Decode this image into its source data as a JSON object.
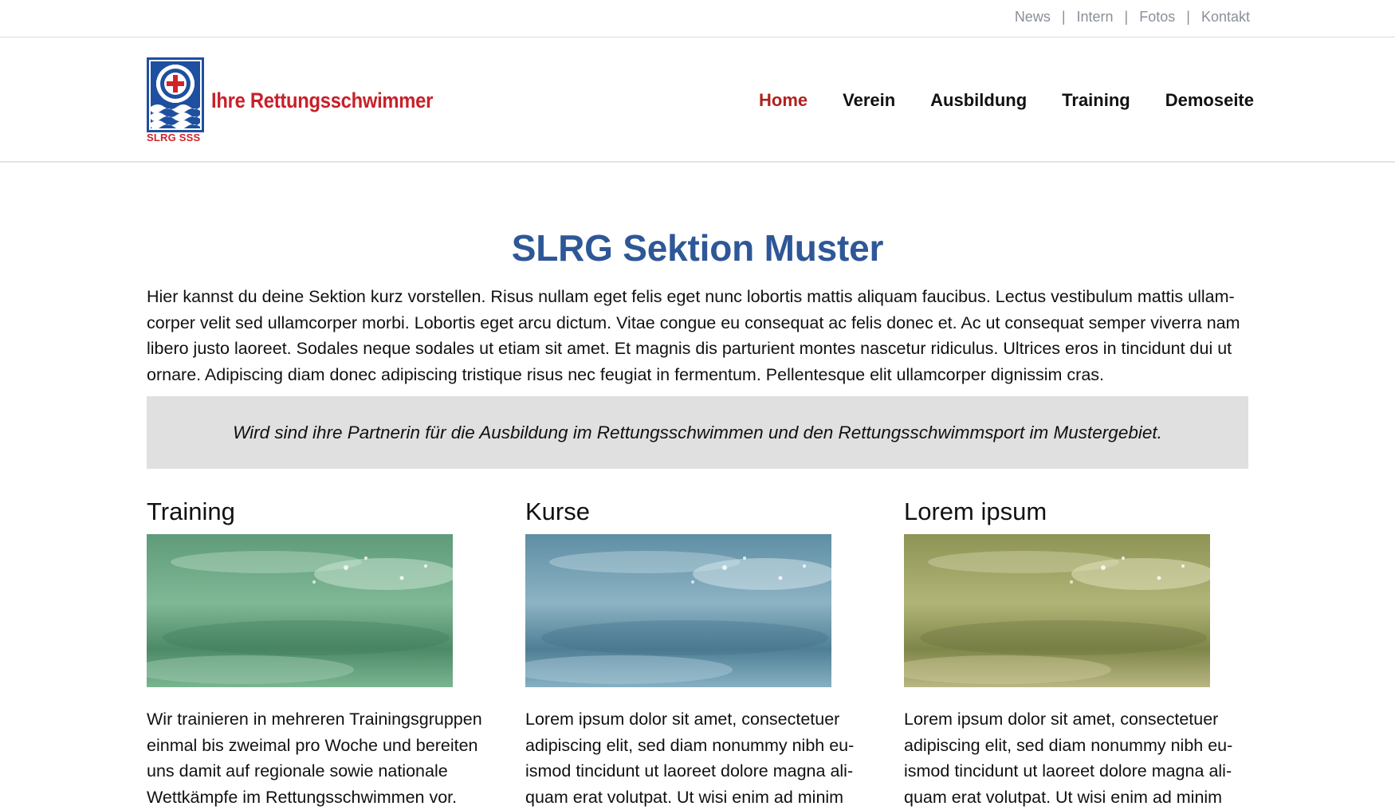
{
  "utility_nav": {
    "items": [
      "News",
      "Intern",
      "Fotos",
      "Kontakt"
    ],
    "separator": "|"
  },
  "logo": {
    "title": "Ihre Rettungsschwimmer",
    "subtitle": "SLRG SSS",
    "icon": "lifebuoy-cross-waves-icon"
  },
  "main_nav": {
    "items": [
      {
        "label": "Home",
        "active": true
      },
      {
        "label": "Verein",
        "active": false
      },
      {
        "label": "Ausbildung",
        "active": false
      },
      {
        "label": "Training",
        "active": false
      },
      {
        "label": "Demoseite",
        "active": false
      }
    ]
  },
  "page": {
    "title": "SLRG Sektion Muster",
    "intro": "Hier kannst du deine Sektion kurz vorstellen. Risus nullam eget felis eget nunc lobortis mattis aliquam faucibus. Lectus vestibulum mattis ullam­corper velit sed ullamcorper morbi. Lobortis eget arcu dictum. Vitae congue eu consequat ac felis donec et. Ac ut consequat semper viverra nam libero justo laoreet. Sodales neque sodales ut etiam sit amet. Et magnis dis parturient montes nascetur ridiculus. Ultrices eros in tincidunt dui ut ornare. Adipiscing diam donec adipiscing tristique risus nec feugiat in fermentum. Pellentesque elit ullamcorper dignissim cras.",
    "quote": "Wird sind ihre Partnerin für die Ausbildung im Rettungsschwimmen und den Rettungsschwimmsport im Mustergebiet."
  },
  "columns": [
    {
      "heading": "Training",
      "text": "Wir trainieren in mehreren Trainingsgruppen einmal bis zweimal pro Woche und bereiten uns damit auf regionale sowie nationale Wettkämpfe im Rettungsschwimmen vor.",
      "image": "water-splash-green"
    },
    {
      "heading": "Kurse",
      "text": "Lorem ipsum dolor sit amet, consectetuer adipiscing elit, sed diam nonummy nibh eu­ismod tincidunt ut laoreet dolore magna ali­quam erat volutpat. Ut wisi enim ad minim",
      "image": "water-splash-blue"
    },
    {
      "heading": "Lorem ipsum",
      "text": "Lorem ipsum dolor sit amet, consectetuer adipiscing elit, sed diam nonummy nibh eu­ismod tincidunt ut laoreet dolore magna ali­quam erat volutpat. Ut wisi enim ad minim",
      "image": "water-splash-olive"
    }
  ],
  "colors": {
    "accent_red": "#c8202a",
    "title_blue": "#2e5797",
    "quote_bg": "#e0e0e0",
    "util_gray": "#8a8f99"
  }
}
